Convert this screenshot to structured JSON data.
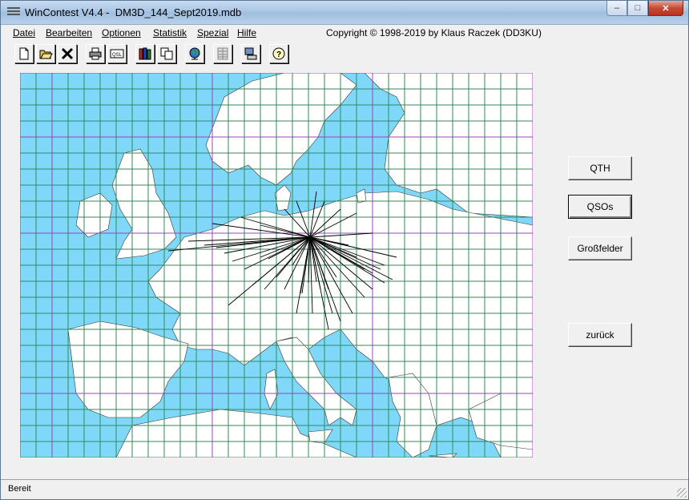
{
  "window": {
    "title": "WinContest V4.4 -  DM3D_144_Sept2019.mdb",
    "minimize_label": "–",
    "maximize_label": "□",
    "close_label": "✕"
  },
  "menu": {
    "items": [
      {
        "label": "Datei"
      },
      {
        "label": "Bearbeiten"
      },
      {
        "label": "Optionen"
      },
      {
        "label": "Statistik"
      },
      {
        "label": "Spezial"
      },
      {
        "label": "Hilfe"
      }
    ],
    "copyright": "Copyright © 1998-2019 by Klaus Raczek (DD3KU)"
  },
  "toolbar": {
    "buttons": [
      {
        "icon": "new-file-icon"
      },
      {
        "icon": "open-folder-icon"
      },
      {
        "icon": "close-x-icon"
      },
      {
        "icon": "printer-icon"
      },
      {
        "icon": "qsl-card-icon",
        "label": "QSL"
      },
      {
        "icon": "books-icon"
      },
      {
        "icon": "copy-icon"
      },
      {
        "icon": "globe-icon"
      },
      {
        "icon": "grid-table-icon"
      },
      {
        "icon": "computer-icon"
      },
      {
        "icon": "help-icon"
      }
    ]
  },
  "map": {
    "colors": {
      "sea": "#80d8f8",
      "land": "#ffffff",
      "grid": "#2e8b57",
      "grid_major": "#a040c0",
      "qso_line": "#000000"
    }
  },
  "buttons": {
    "qth": "QTH",
    "qsos": "QSOs",
    "grossfelder": "Großfelder",
    "zurueck": "zurück"
  },
  "status": {
    "text": "Bereit"
  }
}
